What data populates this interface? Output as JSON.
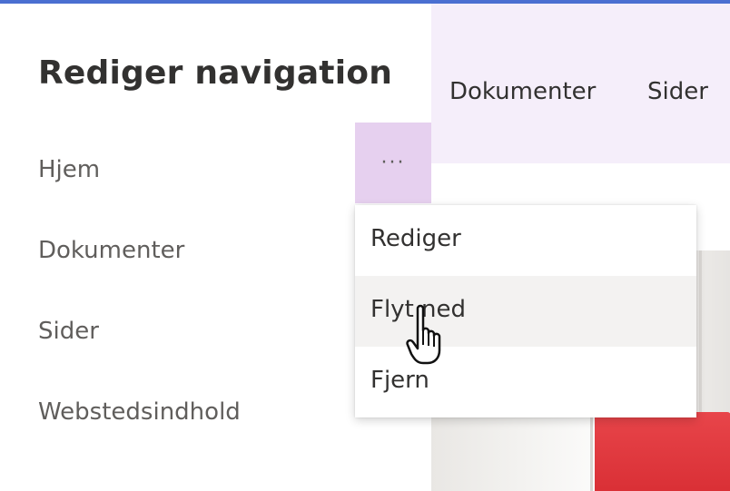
{
  "panel": {
    "title": "Rediger navigation",
    "items": [
      {
        "label": "Hjem"
      },
      {
        "label": "Dokumenter"
      },
      {
        "label": "Sider"
      },
      {
        "label": "Webstedsindhold"
      }
    ],
    "more_button": {
      "label": "···",
      "icon": "more-ellipsis-icon"
    }
  },
  "context_menu": {
    "items": [
      {
        "label": "Rediger"
      },
      {
        "label": "Flyt ned",
        "hovered": true
      },
      {
        "label": "Fjern"
      }
    ]
  },
  "page": {
    "nav_items": [
      {
        "label": "Dokumenter"
      },
      {
        "label": "Sider"
      }
    ]
  },
  "colors": {
    "top_accent": "#4a6fd1",
    "page_nav_bg": "#f5eefa",
    "more_button_bg": "#e6d0ef",
    "menu_hover_bg": "#f3f2f1",
    "lamp_red": "#e8454a"
  },
  "cursor": {
    "icon": "hand-pointer-icon"
  }
}
